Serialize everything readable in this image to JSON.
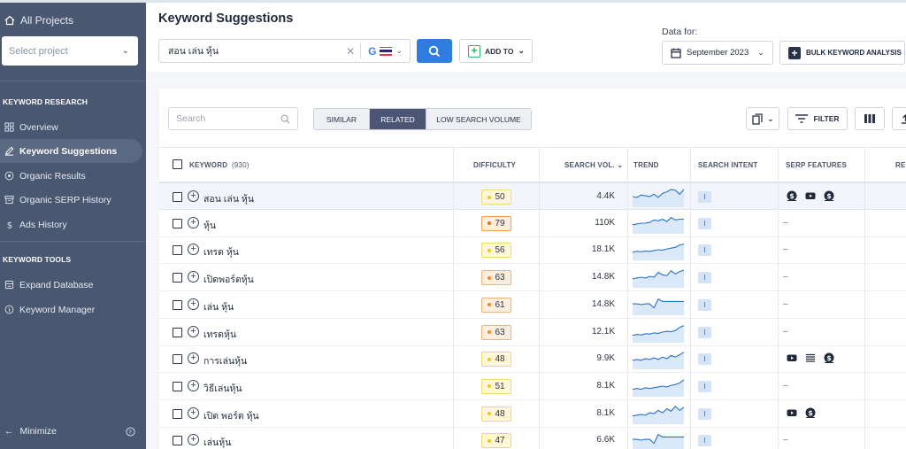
{
  "sidebar": {
    "all_projects": "All Projects",
    "select_project": "Select project",
    "sections": [
      {
        "title": "KEYWORD RESEARCH",
        "items": [
          "Overview",
          "Keyword Suggestions",
          "Organic Results",
          "Organic SERP History",
          "Ads History"
        ]
      },
      {
        "title": "KEYWORD TOOLS",
        "items": [
          "Expand Database",
          "Keyword Manager"
        ]
      }
    ],
    "active_item": "Keyword Suggestions",
    "minimize": "Minimize"
  },
  "header": {
    "title": "Keyword Suggestions",
    "keyword_value": "สอน เล่น หุ้น",
    "add_to": "ADD TO",
    "data_for": "Data for:",
    "month": "September 2023",
    "bulk": "BULK KEYWORD ANALYSIS"
  },
  "toolbar": {
    "search_placeholder": "Search",
    "tabs": [
      "SIMILAR",
      "RELATED",
      "LOW SEARCH VOLUME"
    ],
    "active_tab": "RELATED",
    "filter": "FILTER"
  },
  "table": {
    "columns": {
      "keyword": "KEYWORD",
      "keyword_count": "(930)",
      "difficulty": "DIFFICULTY",
      "search_vol": "SEARCH VOL.",
      "trend": "TREND",
      "intent": "SEARCH INTENT",
      "serp": "SERP FEATURES",
      "last_partial": "RE"
    },
    "rows": [
      {
        "keyword": "สอน เล่น หุ้น",
        "difficulty": "50",
        "level": "easy",
        "volume": "4.4K",
        "intent": "I",
        "serp": [
          "money",
          "youtube",
          "money"
        ],
        "trend": [
          0.5,
          0.55,
          0.4,
          0.45,
          0.5,
          0.35,
          0.55,
          0.3,
          0.2,
          0.05,
          0.1,
          0.35,
          0.05
        ]
      },
      {
        "keyword": "หุ้น",
        "difficulty": "79",
        "level": "hard",
        "volume": "110K",
        "intent": "I",
        "serp": [],
        "trend": [
          0.6,
          0.55,
          0.5,
          0.5,
          0.45,
          0.3,
          0.35,
          0.25,
          0.4,
          0.15,
          0.3,
          0.25,
          0.25
        ]
      },
      {
        "keyword": "เทรด หุ้น",
        "difficulty": "56",
        "level": "easy",
        "volume": "18.1K",
        "intent": "I",
        "serp": [],
        "trend": [
          0.65,
          0.6,
          0.62,
          0.58,
          0.6,
          0.55,
          0.5,
          0.52,
          0.45,
          0.4,
          0.35,
          0.2,
          0.15
        ]
      },
      {
        "keyword": "เปิดพอร์ตหุ้น",
        "difficulty": "63",
        "level": "medium",
        "volume": "14.8K",
        "intent": "I",
        "serp": [],
        "trend": [
          0.6,
          0.55,
          0.5,
          0.55,
          0.45,
          0.5,
          0.2,
          0.35,
          0.4,
          0.1,
          0.3,
          0.15,
          0.05
        ]
      },
      {
        "keyword": "เล่น หุ้น",
        "difficulty": "61",
        "level": "medium",
        "volume": "14.8K",
        "intent": "I",
        "serp": [],
        "trend": [
          0.45,
          0.45,
          0.5,
          0.45,
          0.45,
          0.7,
          0.15,
          0.3,
          0.3,
          0.3,
          0.3,
          0.3,
          0.3
        ]
      },
      {
        "keyword": "เทรดหุ้น",
        "difficulty": "63",
        "level": "medium",
        "volume": "12.1K",
        "intent": "I",
        "serp": [],
        "trend": [
          0.7,
          0.65,
          0.68,
          0.6,
          0.62,
          0.55,
          0.58,
          0.5,
          0.45,
          0.48,
          0.4,
          0.2,
          0.1
        ]
      },
      {
        "keyword": "การเล่นหุ้น",
        "difficulty": "48",
        "level": "easy",
        "volume": "9.9K",
        "intent": "I",
        "serp": [
          "youtube",
          "list",
          "money"
        ],
        "trend": [
          0.6,
          0.55,
          0.6,
          0.5,
          0.55,
          0.45,
          0.55,
          0.4,
          0.5,
          0.3,
          0.4,
          0.25,
          0.1
        ]
      },
      {
        "keyword": "วิธีเล่นหุ้น",
        "difficulty": "51",
        "level": "easy",
        "volume": "8.1K",
        "intent": "I",
        "serp": [],
        "trend": [
          0.7,
          0.65,
          0.7,
          0.6,
          0.65,
          0.6,
          0.55,
          0.5,
          0.55,
          0.45,
          0.4,
          0.3,
          0.1
        ]
      },
      {
        "keyword": "เปิด พอร์ต หุ้น",
        "difficulty": "48",
        "level": "easy",
        "volume": "8.1K",
        "intent": "I",
        "serp": [
          "youtube",
          "money"
        ],
        "trend": [
          0.65,
          0.6,
          0.55,
          0.6,
          0.45,
          0.5,
          0.3,
          0.45,
          0.2,
          0.35,
          0.05,
          0.3,
          0.1
        ]
      },
      {
        "keyword": "เล่นหุ้น",
        "difficulty": "47",
        "level": "easy",
        "volume": "6.6K",
        "intent": "I",
        "serp": [],
        "trend": [
          0.45,
          0.45,
          0.5,
          0.45,
          0.45,
          0.7,
          0.15,
          0.3,
          0.3,
          0.3,
          0.3,
          0.3,
          0.3
        ]
      }
    ],
    "empty_serp": "–"
  },
  "colors": {
    "easy_bg": "#fff7d6",
    "easy_border": "#f0d97a",
    "easy_dot": "#f5c518",
    "medium_bg": "#fdeedd",
    "medium_border": "#f0b37a",
    "medium_dot": "#f08a24",
    "hard_bg": "#fdeedd",
    "hard_border": "#e8a060",
    "hard_dot": "#e8731a",
    "trend_line": "#2a72c8",
    "trend_fill": "#dbe8f7"
  }
}
